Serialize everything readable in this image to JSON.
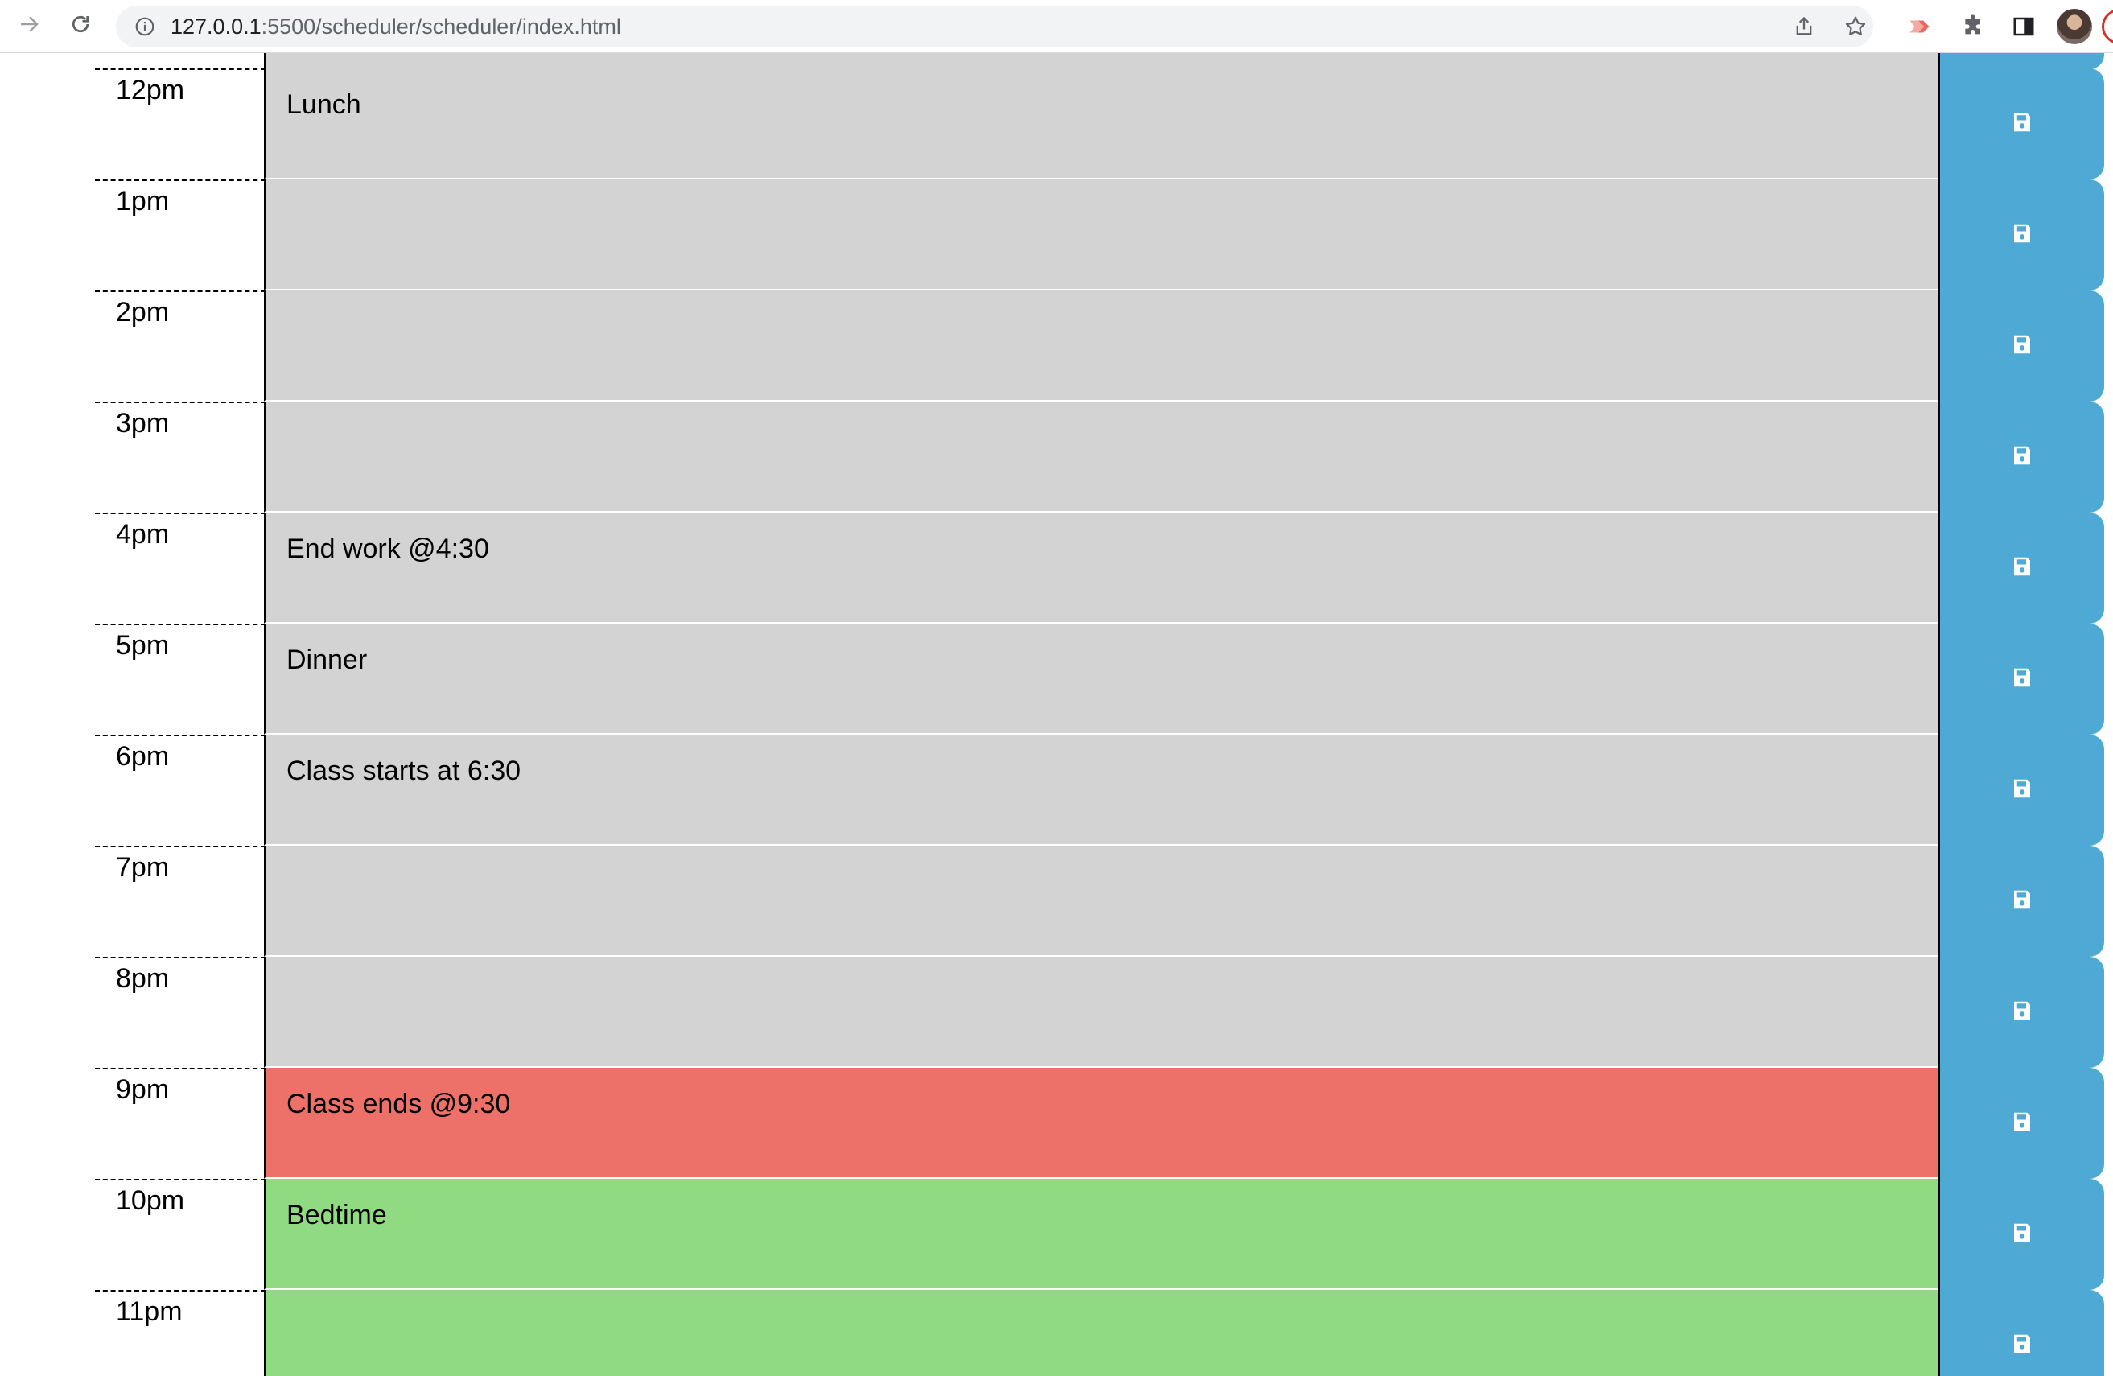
{
  "browser": {
    "url_host": "127.0.0.1",
    "url_rest": ":5500/scheduler/scheduler/index.html",
    "icons": {
      "back": "arrow-left-icon",
      "reload": "reload-icon",
      "info": "info-icon",
      "share": "share-icon",
      "bookmark": "star-icon",
      "extension1": "ext-arrow-icon",
      "extensions": "puzzle-icon",
      "side_panel": "side-panel-icon",
      "profile": "avatar"
    }
  },
  "colors": {
    "past": "#d3d3d3",
    "present": "#ed7168",
    "future": "#90da81",
    "save_button": "#4eaad4"
  },
  "scheduler": {
    "rows": [
      {
        "hour": "12pm",
        "text": "Lunch",
        "state": "past"
      },
      {
        "hour": "1pm",
        "text": "",
        "state": "past"
      },
      {
        "hour": "2pm",
        "text": "",
        "state": "past"
      },
      {
        "hour": "3pm",
        "text": "",
        "state": "past"
      },
      {
        "hour": "4pm",
        "text": "End work @4:30",
        "state": "past"
      },
      {
        "hour": "5pm",
        "text": "Dinner",
        "state": "past"
      },
      {
        "hour": "6pm",
        "text": "Class starts at 6:30",
        "state": "past"
      },
      {
        "hour": "7pm",
        "text": "",
        "state": "past"
      },
      {
        "hour": "8pm",
        "text": "",
        "state": "past"
      },
      {
        "hour": "9pm",
        "text": "Class ends @9:30",
        "state": "present"
      },
      {
        "hour": "10pm",
        "text": "Bedtime",
        "state": "future"
      },
      {
        "hour": "11pm",
        "text": "",
        "state": "future"
      }
    ]
  }
}
